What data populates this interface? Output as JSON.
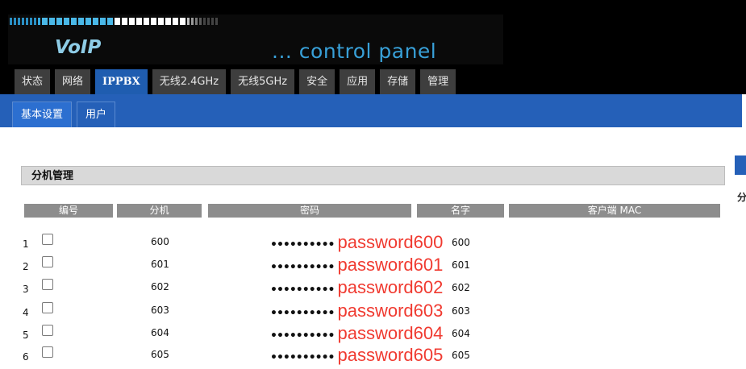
{
  "header": {
    "logo_text": "VoIP",
    "subtitle": "... control panel",
    "main_tabs": [
      {
        "label": "状态"
      },
      {
        "label": "网络"
      },
      {
        "label": "IPPBX",
        "active": true
      },
      {
        "label": "无线2.4GHz"
      },
      {
        "label": "无线5GHz"
      },
      {
        "label": "安全"
      },
      {
        "label": "应用"
      },
      {
        "label": "存储"
      },
      {
        "label": "管理"
      }
    ],
    "accent_color": "#1f5db0"
  },
  "sub_tabs": [
    {
      "label": "基本设置",
      "active": true
    },
    {
      "label": "用户"
    }
  ],
  "section": {
    "title": "分机管理",
    "columns": [
      "编号",
      "分机",
      "密码",
      "名字",
      "客户端 MAC"
    ],
    "rows": [
      {
        "index": "1",
        "extension": "600",
        "password_dots": "••••••••••",
        "password_text": "password600",
        "name": "600",
        "checked": false
      },
      {
        "index": "2",
        "extension": "601",
        "password_dots": "••••••••••",
        "password_text": "password601",
        "name": "601",
        "checked": false
      },
      {
        "index": "3",
        "extension": "602",
        "password_dots": "••••••••••",
        "password_text": "password602",
        "name": "602",
        "checked": false
      },
      {
        "index": "4",
        "extension": "603",
        "password_dots": "••••••••••",
        "password_text": "password603",
        "name": "603",
        "checked": false
      },
      {
        "index": "5",
        "extension": "604",
        "password_dots": "••••••••••",
        "password_text": "password604",
        "name": "604",
        "checked": false
      },
      {
        "index": "6",
        "extension": "605",
        "password_dots": "••••••••••",
        "password_text": "password605",
        "name": "605",
        "checked": false
      }
    ]
  },
  "right_panel": {
    "char": "分"
  },
  "colors": {
    "password_annotation": "#f03a30",
    "header_bg": "#000000",
    "blue_bar": "#2560b8"
  }
}
